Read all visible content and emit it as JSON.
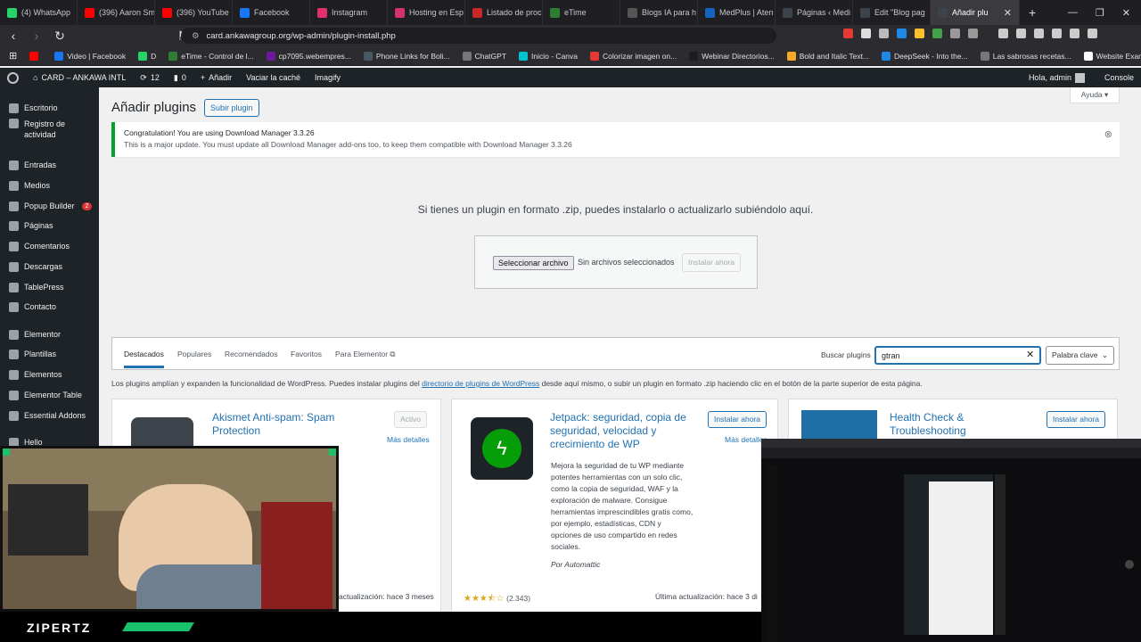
{
  "browser": {
    "tabs": [
      {
        "label": "(4) WhatsApp",
        "color": "#25d366"
      },
      {
        "label": "(396) Aaron Sm",
        "color": "#ff0000"
      },
      {
        "label": "(396) YouTube",
        "color": "#ff0000"
      },
      {
        "label": "Facebook",
        "color": "#1877f2"
      },
      {
        "label": "Instagram",
        "color": "#e1306c"
      },
      {
        "label": "Hosting en Esp",
        "color": "#d6336c"
      },
      {
        "label": "Listado de proc",
        "color": "#c62828"
      },
      {
        "label": "eTime",
        "color": "#2e7d32"
      },
      {
        "label": "Blogs IA para h",
        "color": "#555555"
      },
      {
        "label": "MedPlus | Aten",
        "color": "#1565c0"
      },
      {
        "label": "Páginas ‹ Medi",
        "color": "#3c434a"
      },
      {
        "label": "Edit \"Blog pag",
        "color": "#3c434a"
      }
    ],
    "active_tab": {
      "label": "Añadir plu",
      "color": "#3c434a"
    },
    "new_tab": "+",
    "url": "card.ankawagroup.org/wp-admin/plugin-install.php",
    "bookmarks": [
      {
        "label": "",
        "color": "#ff0000"
      },
      {
        "label": "Video | Facebook",
        "color": "#1877f2"
      },
      {
        "label": "D",
        "color": "#25d366"
      },
      {
        "label": "eTime - Control de l...",
        "color": "#2e7d32"
      },
      {
        "label": "cp7095.webempres...",
        "color": "#6a1b9a"
      },
      {
        "label": "Phone Links for Boli...",
        "color": "#455a64"
      },
      {
        "label": "ChatGPT",
        "color": "#777777"
      },
      {
        "label": "Inicio - Canva",
        "color": "#00c4cc"
      },
      {
        "label": "Colorizar imagen on...",
        "color": "#e53935"
      },
      {
        "label": "Webinar Directorios...",
        "color": "#1d1d1d"
      },
      {
        "label": "Bold and Italic Text...",
        "color": "#f9a825"
      },
      {
        "label": "DeepSeek - Into the...",
        "color": "#1e88e5"
      },
      {
        "label": "Las sabrosas recetas...",
        "color": "#777777"
      },
      {
        "label": "Website Examples...",
        "color": "#ffffff"
      }
    ]
  },
  "adminbar": {
    "site": "CARD – ANKAWA INTL",
    "updates": "12",
    "comments": "0",
    "new": "Añadir",
    "cache": "Vaciar la caché",
    "imagify": "Imagify",
    "greeting": "Hola, admin",
    "console": "Console"
  },
  "sidebar": {
    "items": [
      {
        "label": "Escritorio"
      },
      {
        "label": "Registro de actividad"
      },
      {
        "label": "Entradas"
      },
      {
        "label": "Medios"
      },
      {
        "label": "Popup Builder",
        "badge": "2"
      },
      {
        "label": "Páginas"
      },
      {
        "label": "Comentarios"
      },
      {
        "label": "Descargas"
      },
      {
        "label": "TablePress"
      },
      {
        "label": "Contacto"
      },
      {
        "label": "Elementor"
      },
      {
        "label": "Plantillas"
      },
      {
        "label": "Elementos"
      },
      {
        "label": "Elementor Table"
      },
      {
        "label": "Essential Addons"
      },
      {
        "label": "Hello"
      }
    ]
  },
  "page": {
    "title": "Añadir plugins",
    "upload_button": "Subir plugin",
    "help": "Ayuda ▾",
    "notice_line1": "Congratulation! You are using Download Manager 3.3.26",
    "notice_line2": "This is a major update. You must update all Download Manager add-ons too, to keep them compatible with Download Manager 3.3.26",
    "upload_text": "Si tienes un plugin en formato .zip, puedes instalarlo o actualizarlo subiéndolo aquí.",
    "file_button": "Seleccionar archivo",
    "no_file": "Sin archivos seleccionados",
    "install_now": "Instalar ahora"
  },
  "filter": {
    "tabs": [
      "Destacados",
      "Populares",
      "Recomendados",
      "Favoritos",
      "Para Elementor ⧉"
    ],
    "search_label": "Buscar plugins",
    "search_value": "gtran",
    "search_type": "Palabra clave"
  },
  "info": {
    "before": "Los plugins amplían y expanden la funcionalidad de WordPress. Puedes instalar plugins del ",
    "link": "directorio de plugins de WordPress",
    "after": " desde aquí mismo, o subir un plugin en formato .zip haciendo clic en el botón de la parte superior de esta página."
  },
  "plugins": [
    {
      "name": "Akismet Anti-spam: Spam Protection",
      "button": "Activo",
      "more": "Más detalles",
      "updated": "actualización: hace 3 meses"
    },
    {
      "name": "Jetpack: seguridad, copia de seguridad, velocidad y crecimiento de WP",
      "button": "Instalar ahora",
      "more": "Más detalles",
      "desc": "Mejora la seguridad de tu WP mediante potentes herramientas con un solo clic, como la copia de seguridad, WAF y la exploración de malware. Consigue herramientas imprescindibles gratis como, por ejemplo, estadísticas, CDN y opciones de uso compartido en redes sociales.",
      "author": "Por Automattic",
      "rating": "(2.343)",
      "updated": "Última actualización: hace 3 di",
      "stars": 3.5,
      "color": "#069e08"
    },
    {
      "name": "Health Check & Troubleshooting",
      "button": "Instalar ahora",
      "color": "#1e6fa6"
    }
  ],
  "overlay": {
    "streamer_label": "ZIPERTZ"
  }
}
